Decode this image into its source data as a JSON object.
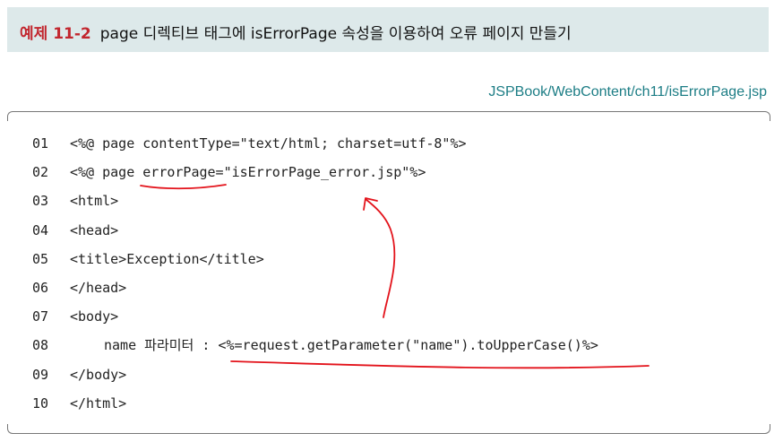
{
  "header": {
    "example_number": "예제 11-2",
    "title": "page 디렉티브 태그에 isErrorPage 속성을 이용하여 오류 페이지 만들기"
  },
  "file_path": "JSPBook/WebContent/ch11/isErrorPage.jsp",
  "code": [
    {
      "num": "01",
      "text": "<%@ page contentType=\"text/html; charset=utf-8\"%>"
    },
    {
      "num": "02",
      "text": "<%@ page errorPage=\"isErrorPage_error.jsp\"%>"
    },
    {
      "num": "03",
      "text": "<html>"
    },
    {
      "num": "04",
      "text": "<head>"
    },
    {
      "num": "05",
      "text": "<title>Exception</title>"
    },
    {
      "num": "06",
      "text": "</head>"
    },
    {
      "num": "07",
      "text": "<body>"
    },
    {
      "num": "08",
      "text": "name 파라미터 : <%=request.getParameter(\"name\").toUpperCase()%>"
    },
    {
      "num": "09",
      "text": "</body>"
    },
    {
      "num": "10",
      "text": "</html>"
    }
  ],
  "colors": {
    "header_bg": "#dde9ea",
    "example_number": "#c2262e",
    "file_path": "#1c7d85",
    "annotation": "#e3131b"
  }
}
